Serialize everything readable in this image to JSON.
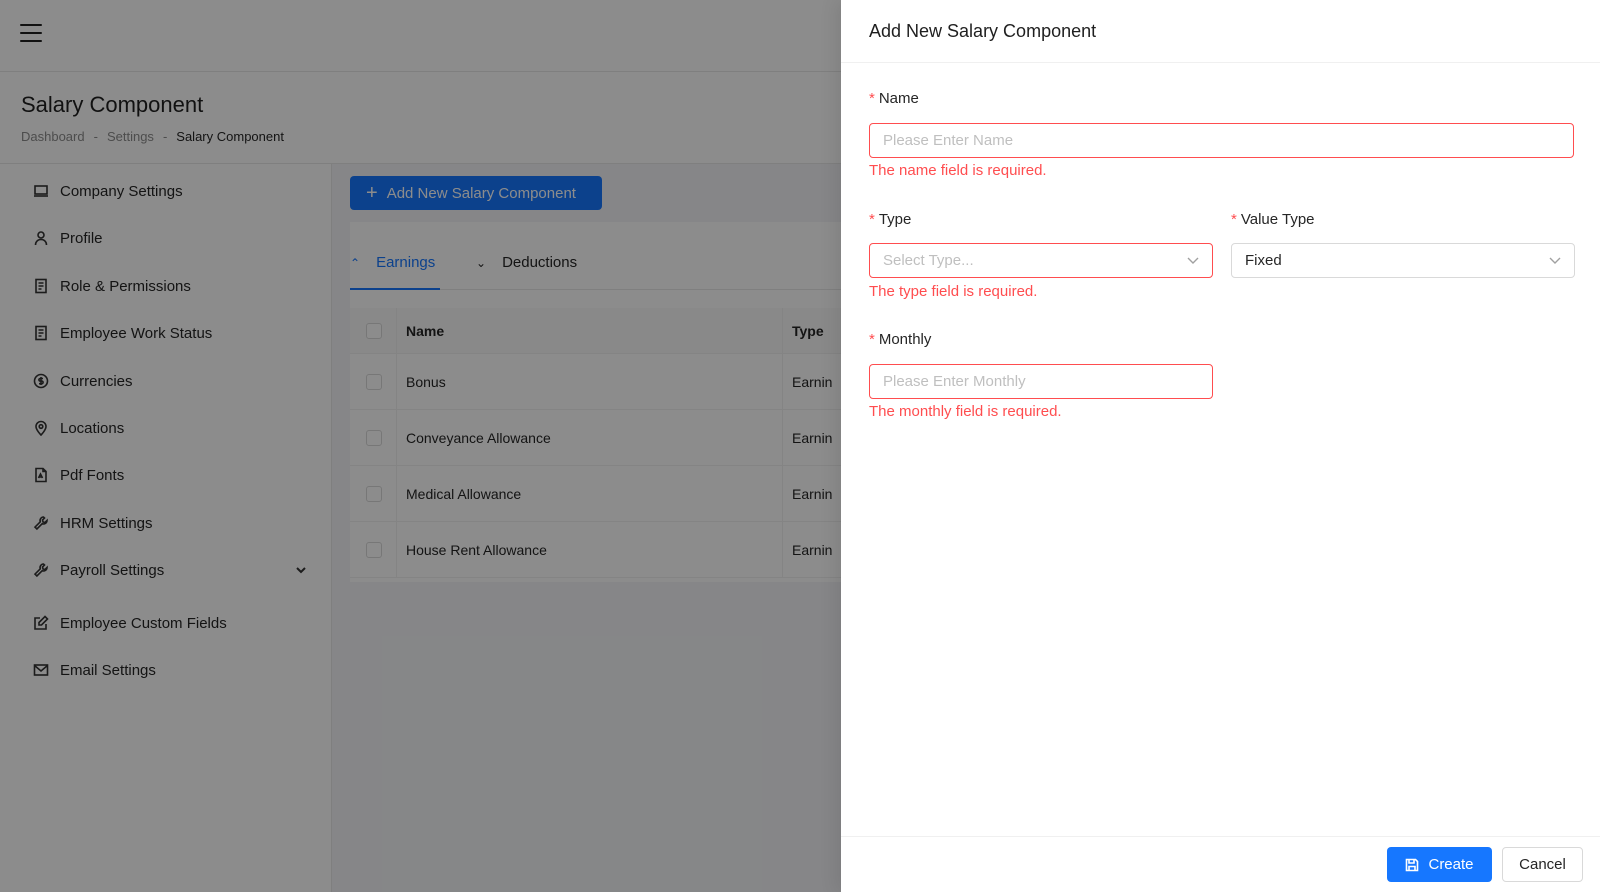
{
  "header": {
    "menu_icon": "hamburger-icon"
  },
  "page": {
    "title": "Salary Component",
    "breadcrumb": [
      "Dashboard",
      "Settings",
      "Salary Component"
    ],
    "breadcrumb_sep": "-"
  },
  "sidebar": {
    "items": [
      {
        "label": "Company Settings",
        "icon": "laptop-icon"
      },
      {
        "label": "Profile",
        "icon": "user-icon"
      },
      {
        "label": "Role & Permissions",
        "icon": "document-icon"
      },
      {
        "label": "Employee Work Status",
        "icon": "document-icon"
      },
      {
        "label": "Currencies",
        "icon": "dollar-circle-icon"
      },
      {
        "label": "Locations",
        "icon": "location-pin-icon"
      },
      {
        "label": "Pdf Fonts",
        "icon": "pdf-file-icon"
      },
      {
        "label": "HRM Settings",
        "icon": "wrench-icon"
      },
      {
        "label": "Payroll Settings",
        "icon": "wrench-icon",
        "expand_icon": "chevron-down-icon"
      },
      {
        "label": "Employee Custom Fields",
        "icon": "edit-icon"
      },
      {
        "label": "Email Settings",
        "icon": "mail-icon"
      }
    ]
  },
  "content": {
    "add_button": "Add New Salary Component",
    "tabs": [
      {
        "label": "Earnings",
        "active": true
      },
      {
        "label": "Deductions",
        "active": false
      }
    ],
    "table": {
      "columns": [
        "Name",
        "Type"
      ],
      "rows": [
        {
          "name": "Bonus",
          "type": "Earnin"
        },
        {
          "name": "Conveyance Allowance",
          "type": "Earnin"
        },
        {
          "name": "Medical Allowance",
          "type": "Earnin"
        },
        {
          "name": "House Rent Allowance",
          "type": "Earnin"
        }
      ]
    }
  },
  "drawer": {
    "title": "Add New Salary Component",
    "required_mark": "*",
    "fields": {
      "name": {
        "label": "Name",
        "placeholder": "Please Enter Name",
        "value": "",
        "error": "The name field is required."
      },
      "type": {
        "label": "Type",
        "placeholder": "Select Type...",
        "value": "",
        "error": "The type field is required."
      },
      "value_type": {
        "label": "Value Type",
        "value": "Fixed"
      },
      "monthly": {
        "label": "Monthly",
        "placeholder": "Please Enter Monthly",
        "value": "",
        "error": "The monthly field is required."
      }
    },
    "footer": {
      "create_label": "Create",
      "cancel_label": "Cancel"
    }
  },
  "colors": {
    "primary": "#1677ff",
    "error": "#ff4d4f",
    "overlay": "rgba(0,0,0,0.45)"
  }
}
